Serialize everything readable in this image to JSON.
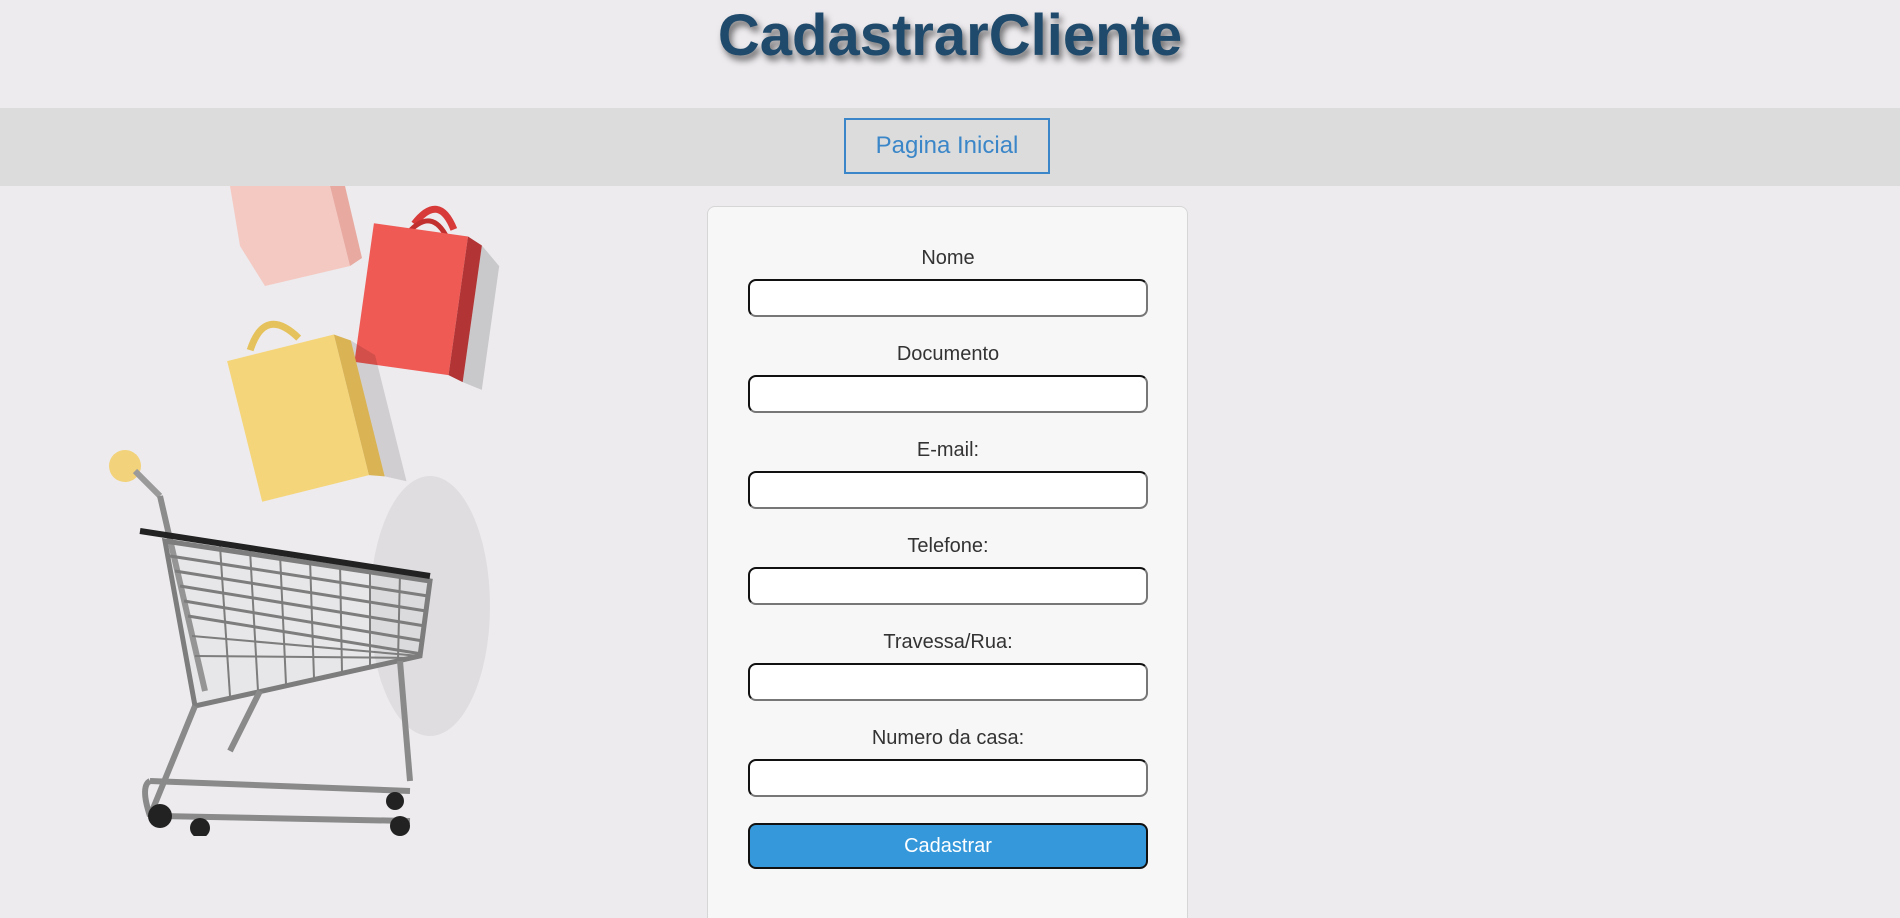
{
  "page": {
    "title": "CadastrarCliente"
  },
  "nav": {
    "home_label": "Pagina Inicial"
  },
  "form": {
    "fields": [
      {
        "label": "Nome",
        "value": "",
        "placeholder": ""
      },
      {
        "label": "Documento",
        "value": "",
        "placeholder": ""
      },
      {
        "label": "E-mail:",
        "value": "",
        "placeholder": ""
      },
      {
        "label": "Telefone:",
        "value": "",
        "placeholder": ""
      },
      {
        "label": "Travessa/Rua:",
        "value": "",
        "placeholder": ""
      },
      {
        "label": "Numero da casa:",
        "value": "",
        "placeholder": ""
      }
    ],
    "submit_label": "Cadastrar"
  },
  "colors": {
    "title": "#1f4a6b",
    "accent": "#3598db",
    "nav_bar": "#dcdcdc",
    "background": "#edebee"
  },
  "hero": {
    "icon": "shopping-cart-with-bags-illustration"
  }
}
